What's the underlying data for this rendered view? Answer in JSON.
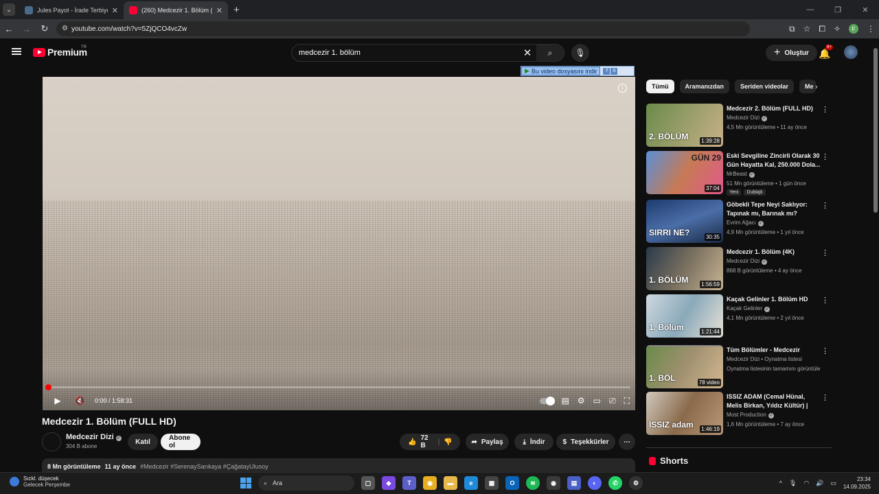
{
  "browser": {
    "tabs": [
      {
        "title": "Jules Payot - İrade Terbiyesi : Fi",
        "active": false
      },
      {
        "title": "(260) Medcezir 1. Bölüm (FULL",
        "active": true
      }
    ],
    "url": "youtube.com/watch?v=5ZjQCO4vcZw",
    "profile_initial": "F"
  },
  "youtube": {
    "logo_text": "Premium",
    "logo_country": "TR",
    "search_query": "medcezir 1. bölüm",
    "create_label": "Oluştur",
    "notification_count": "9+"
  },
  "download_banner": {
    "label": "Bu video dosyasını indir",
    "help": "?",
    "close": "X"
  },
  "player": {
    "time": "0:00 / 1:58:31",
    "progress_fraction": 0.0
  },
  "video": {
    "title": "Medcezir 1. Bölüm (FULL HD)",
    "channel": "Medcezir Dizi",
    "subscribers": "304 B abone",
    "join_label": "Katıl",
    "subscribe_label": "Abone ol",
    "likes": "72 B",
    "share_label": "Paylaş",
    "download_label": "İndir",
    "thanks_label": "Teşekkürler",
    "views": "8 Mn görüntüleme",
    "age": "11 ay önce",
    "tags": "#Medcezir #SerenaySarıkaya #ÇağatayUlusoy"
  },
  "sidebar": {
    "chips": [
      "Tümü",
      "Aramanızdan",
      "Seriden videolar",
      "Me"
    ],
    "recommendations": [
      {
        "title": "Medcezir 2. Bölüm (FULL HD)",
        "channel": "Medcezir Dizi",
        "meta": "4,5 Mn görüntüleme • 11 ay önce",
        "duration": "1:39:28",
        "overlay": "2. BÖLÜM",
        "c1": "#6a8b4a",
        "c2": "#c9b08a"
      },
      {
        "title": "Eski Sevgiline Zincirli Olarak 30 Gün Hayatta Kal, 250.000 Dola...",
        "channel": "MrBeast",
        "meta": "51 Mn görüntüleme • 1 gün önce",
        "duration": "37:04",
        "overlay": "GÜN 29",
        "badges": [
          "Yeni",
          "Dublajlı"
        ],
        "c1": "#5a8fd6",
        "c2": "#e05a8a"
      },
      {
        "title": "Göbekli Tepe Neyi Saklıyor: Tapınak mı, Barınak mı?",
        "channel": "Evrim Ağacı",
        "meta": "4,9 Mn görüntüleme • 1 yıl önce",
        "duration": "30:35",
        "overlay": "SIRRI NE?",
        "c1": "#1d3b6e",
        "c2": "#4b6ea8"
      },
      {
        "title": "Medcezir 1. Bölüm (4K)",
        "channel": "Medcezir Dizi",
        "meta": "868 B görüntüleme • 4 ay önce",
        "duration": "1:56:59",
        "overlay": "1. BÖLÜM",
        "c1": "#2a3a4a",
        "c2": "#c8b493"
      },
      {
        "title": "Kaçak Gelinler 1. Bölüm HD",
        "channel": "Kaçak Gelinler",
        "meta": "4,1 Mn görüntüleme • 2 yıl önce",
        "duration": "1:21:44",
        "overlay": "1. Bölüm",
        "c1": "#cfd8e0",
        "c2": "#8aa9b9"
      },
      {
        "title": "Tüm Bölümler - Medcezir",
        "channel": "Medcezir Dizi • Oynatma listesi",
        "meta": "Oynatma listesinin tamamını görüntüle",
        "duration": "78 video",
        "overlay": "1. BÖL",
        "c1": "#6a8b4a",
        "c2": "#d4b890"
      },
      {
        "title": "ISSIZ ADAM (Cemal Hünal, Melis Birkan, Yıldız Kültür) | Fu...",
        "channel": "Most Production",
        "meta": "1,6 Mn görüntüleme • 7 ay önce",
        "duration": "1:46:19",
        "overlay": "ISSIZ adam",
        "c1": "#d0c8bd",
        "c2": "#8a6a4a"
      }
    ],
    "shorts_label": "Shorts"
  },
  "taskbar": {
    "weather_title": "Sıckl. düşecek",
    "weather_sub": "Gelecek Perşembe",
    "search_label": "Ara",
    "time": "23:34",
    "date": "14.09.2025"
  }
}
